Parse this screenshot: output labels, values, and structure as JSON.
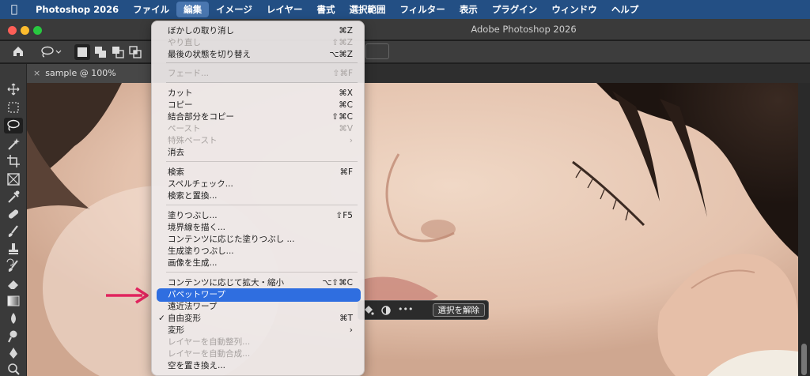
{
  "menubar": {
    "apple_icon": "apple-logo-icon",
    "items": [
      "Photoshop 2026",
      "ファイル",
      "編集",
      "イメージ",
      "レイヤー",
      "書式",
      "選択範囲",
      "フィルター",
      "表示",
      "プラグイン",
      "ウィンドウ",
      "ヘルプ"
    ],
    "active_index": 2
  },
  "window": {
    "title": "Adobe Photoshop 2026",
    "traffic_colors": [
      "#fe5f57",
      "#febc2e",
      "#28c840"
    ]
  },
  "document": {
    "tab_label": "sample @ 100% (RGB/8*)",
    "close_icon": "close-icon"
  },
  "taskbar": {
    "deselect_label": "選択を解除",
    "more_label": "•••"
  },
  "edit_menu": {
    "items": [
      {
        "label": "ぼかしの取り消し",
        "shortcut": "⌘Z",
        "disabled": false
      },
      {
        "label": "やり直し",
        "shortcut": "⇧⌘Z",
        "disabled": true
      },
      {
        "label": "最後の状態を切り替え",
        "shortcut": "⌥⌘Z",
        "disabled": false
      },
      {
        "label": "フェード...",
        "shortcut": "⇧⌘F",
        "disabled": true
      },
      {
        "label": "カット",
        "shortcut": "⌘X",
        "disabled": false
      },
      {
        "label": "コピー",
        "shortcut": "⌘C",
        "disabled": false
      },
      {
        "label": "結合部分をコピー",
        "shortcut": "⇧⌘C",
        "disabled": false
      },
      {
        "label": "ペースト",
        "shortcut": "⌘V",
        "disabled": true
      },
      {
        "label": "特殊ペースト",
        "shortcut": "›",
        "disabled": true
      },
      {
        "label": "消去",
        "shortcut": "",
        "disabled": false
      },
      {
        "label": "検索",
        "shortcut": "⌘F",
        "disabled": false
      },
      {
        "label": "スペルチェック...",
        "shortcut": "",
        "disabled": false
      },
      {
        "label": "検索と置換...",
        "shortcut": "",
        "disabled": false
      },
      {
        "label": "塗りつぶし...",
        "shortcut": "⇧F5",
        "disabled": false
      },
      {
        "label": "境界線を描く...",
        "shortcut": "",
        "disabled": false
      },
      {
        "label": "コンテンツに応じた塗りつぶし ...",
        "shortcut": "",
        "disabled": false
      },
      {
        "label": "生成塗りつぶし...",
        "shortcut": "",
        "disabled": false
      },
      {
        "label": "画像を生成...",
        "shortcut": "",
        "disabled": false
      },
      {
        "label": "コンテンツに応じて拡大・縮小",
        "shortcut": "⌥⇧⌘C",
        "disabled": false
      },
      {
        "label": "パペットワープ",
        "shortcut": "",
        "disabled": false,
        "highlighted": true
      },
      {
        "label": "遠近法ワープ",
        "shortcut": "",
        "disabled": false
      },
      {
        "label": "自由変形",
        "shortcut": "⌘T",
        "disabled": false,
        "checked": true
      },
      {
        "label": "変形",
        "shortcut": "›",
        "disabled": false
      },
      {
        "label": "レイヤーを自動整列...",
        "shortcut": "",
        "disabled": true
      },
      {
        "label": "レイヤーを自動合成...",
        "shortcut": "",
        "disabled": true
      },
      {
        "label": "空を置き換え...",
        "shortcut": "",
        "disabled": false
      }
    ]
  },
  "annotation": {
    "arrow_color": "#e0245e",
    "arrow_icon": "right-arrow-icon"
  },
  "tool_icons": [
    "move-icon",
    "marquee-icon",
    "lasso-icon",
    "magic-wand-icon",
    "crop-icon",
    "frame-icon",
    "eyedropper-icon",
    "healing-brush-icon",
    "brush-icon",
    "clone-stamp-icon",
    "history-brush-icon",
    "eraser-icon",
    "gradient-icon",
    "blur-icon",
    "dodge-icon",
    "pen-icon",
    "zoom-icon"
  ]
}
